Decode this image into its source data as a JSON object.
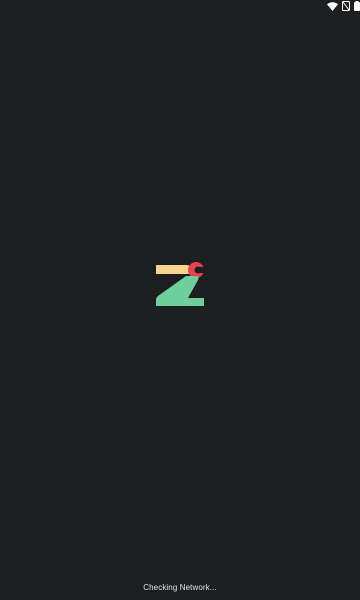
{
  "status_bar": {
    "icons": [
      "wifi-icon",
      "signal-off-icon",
      "battery-icon"
    ]
  },
  "splash": {
    "logo": "app-logo",
    "loading_text": "Checking Network...",
    "colors": {
      "background": "#1d1e20",
      "logo_top": "#f6d48f",
      "logo_bottom": "#6fcf9c",
      "logo_accent": "#e8424f"
    }
  }
}
